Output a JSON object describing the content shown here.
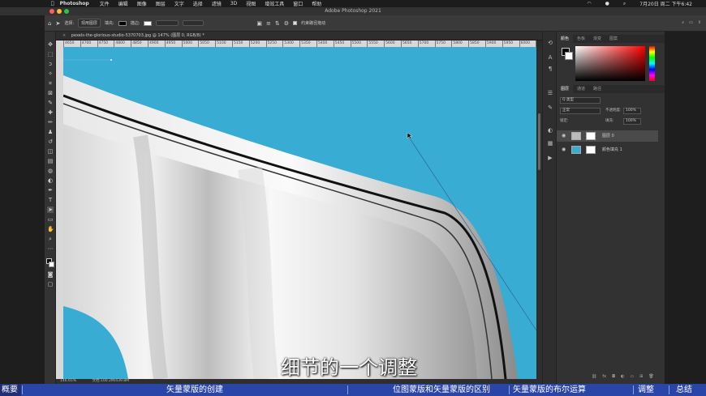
{
  "menubar": {
    "app_name": "Photoshop",
    "items": [
      "文件",
      "编辑",
      "图像",
      "图层",
      "文字",
      "选择",
      "滤镜",
      "3D",
      "视图",
      "增效工具",
      "窗口",
      "帮助"
    ],
    "clock": "7月20日 周二 下午6:42"
  },
  "window": {
    "title": "Adobe Photoshop 2021"
  },
  "options": {
    "select_label": "选择:",
    "select_value": "现用图层",
    "fill_label": "填充:",
    "stroke_label": "描边:",
    "auto_select": "约束路径拖动"
  },
  "document": {
    "tab_title": "pexels-the-glorious-studio-5370703.jpg @ 147% (图层 0, RGB/8) *",
    "ruler_ticks": [
      "4650",
      "4700",
      "4750",
      "4800",
      "4850",
      "4900",
      "4950",
      "5000",
      "5050",
      "5100",
      "5150",
      "5200",
      "5250",
      "5300",
      "5350",
      "5400",
      "5450",
      "5500",
      "5550",
      "5600",
      "5650",
      "5700",
      "5750",
      "5800",
      "5850",
      "5900",
      "5950",
      "6000",
      "6050",
      "6100",
      "6150",
      "6200",
      "6250",
      "6300"
    ],
    "zoom": "146.65%",
    "doc_info": "文档:100.2M/439.8M"
  },
  "panels": {
    "color_tabs": [
      "颜色",
      "色板",
      "渐变",
      "图案"
    ],
    "layer_tabs": [
      "图层",
      "通道",
      "路径"
    ],
    "kind_label": "Q 类型",
    "blend_mode": "正常",
    "opacity_label": "不透明度:",
    "opacity_value": "100%",
    "lock_label": "锁定:",
    "fill_label": "填充:",
    "fill_value": "100%",
    "layers": [
      {
        "name": "图层 0"
      },
      {
        "name": "颜色填充 1"
      }
    ]
  },
  "subtitle": "细节的一个调整",
  "chapters": [
    "概要",
    "矢量蒙版的创建",
    "位图蒙版和矢量蒙版的区别",
    "矢量蒙版的布尔运算",
    "调整",
    "总结"
  ],
  "colors": {
    "canvas_bg": "#39acd3",
    "chapter_bar": "#2a45a8",
    "chapter_active": "#1f2f76"
  }
}
